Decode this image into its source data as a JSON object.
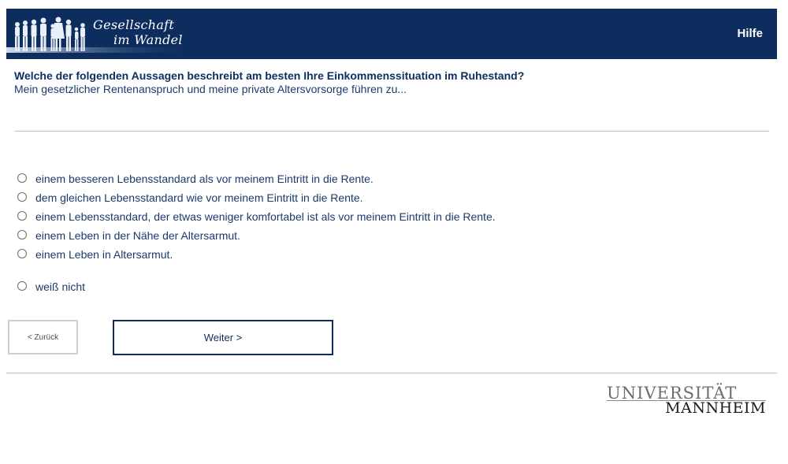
{
  "header": {
    "logo_line1": "Gesellschaft",
    "logo_line2": "im Wandel",
    "help_label": "Hilfe",
    "background_color": "#0e2d5f"
  },
  "question": {
    "title": "Welche der folgenden Aussagen beschreibt am besten Ihre Einkommenssituation im Ruhestand?",
    "subtitle": "Mein gesetzlicher Rentenanspruch und meine private Altersvorsorge führen zu..."
  },
  "options": [
    {
      "label": "einem besseren Lebensstandard als vor meinem Eintritt in die Rente.",
      "selected": false
    },
    {
      "label": "dem gleichen Lebensstandard wie vor meinem Eintritt in die Rente.",
      "selected": false
    },
    {
      "label": "einem Lebensstandard, der etwas weniger komfortabel ist als vor meinem Eintritt in die Rente.",
      "selected": false
    },
    {
      "label": "einem Leben in der Nähe der Altersarmut.",
      "selected": false
    },
    {
      "label": "einem Leben in Altersarmut.",
      "selected": false
    },
    {
      "label": "weiß nicht",
      "selected": false
    }
  ],
  "nav": {
    "back_label": "< Zurück",
    "next_label": "Weiter >"
  },
  "footer": {
    "university_line1": "UNIVERSITÄT",
    "university_line2": "MANNHEIM"
  }
}
